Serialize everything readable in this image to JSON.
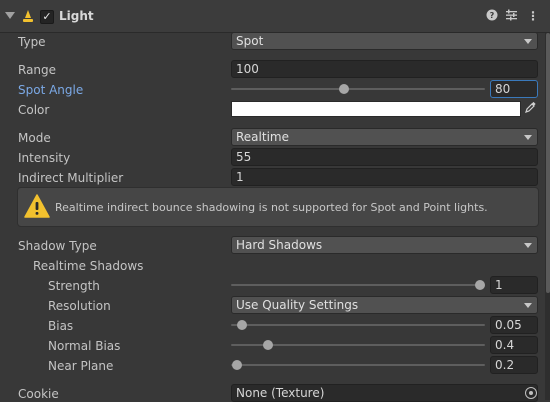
{
  "header": {
    "title": "Light",
    "enabled_check": "✓",
    "help_icon": "?",
    "presets_icon": "⇵",
    "menu_icon": "⋮"
  },
  "rows": {
    "type": {
      "label": "Type",
      "value": "Spot"
    },
    "range": {
      "label": "Range",
      "value": "100"
    },
    "spot_angle": {
      "label": "Spot Angle",
      "value": "80",
      "slider_fraction": 0.45
    },
    "color": {
      "label": "Color",
      "swatch": "#ffffff"
    },
    "mode": {
      "label": "Mode",
      "value": "Realtime"
    },
    "intensity": {
      "label": "Intensity",
      "value": "55"
    },
    "indirect_multiplier": {
      "label": "Indirect Multiplier",
      "value": "1"
    },
    "warning": {
      "text": "Realtime indirect bounce shadowing is not supported for Spot and Point lights."
    },
    "shadow_type": {
      "label": "Shadow Type",
      "value": "Hard Shadows"
    },
    "realtime_shadows": {
      "label": "Realtime Shadows"
    },
    "strength": {
      "label": "Strength",
      "value": "1",
      "slider_fraction": 1.0
    },
    "resolution": {
      "label": "Resolution",
      "value": "Use Quality Settings"
    },
    "bias": {
      "label": "Bias",
      "value": "0.05",
      "slider_fraction": 0.025
    },
    "normal_bias": {
      "label": "Normal Bias",
      "value": "0.4",
      "slider_fraction": 0.133
    },
    "near_plane": {
      "label": "Near Plane",
      "value": "0.2",
      "slider_fraction": 0.0
    },
    "cookie": {
      "label": "Cookie",
      "value": "None (Texture)"
    }
  },
  "colors": {
    "background": "#383838",
    "accent_label": "#7ba9e6",
    "focus_border": "#3a79bb",
    "warning_yellow": "#f2c12e"
  }
}
